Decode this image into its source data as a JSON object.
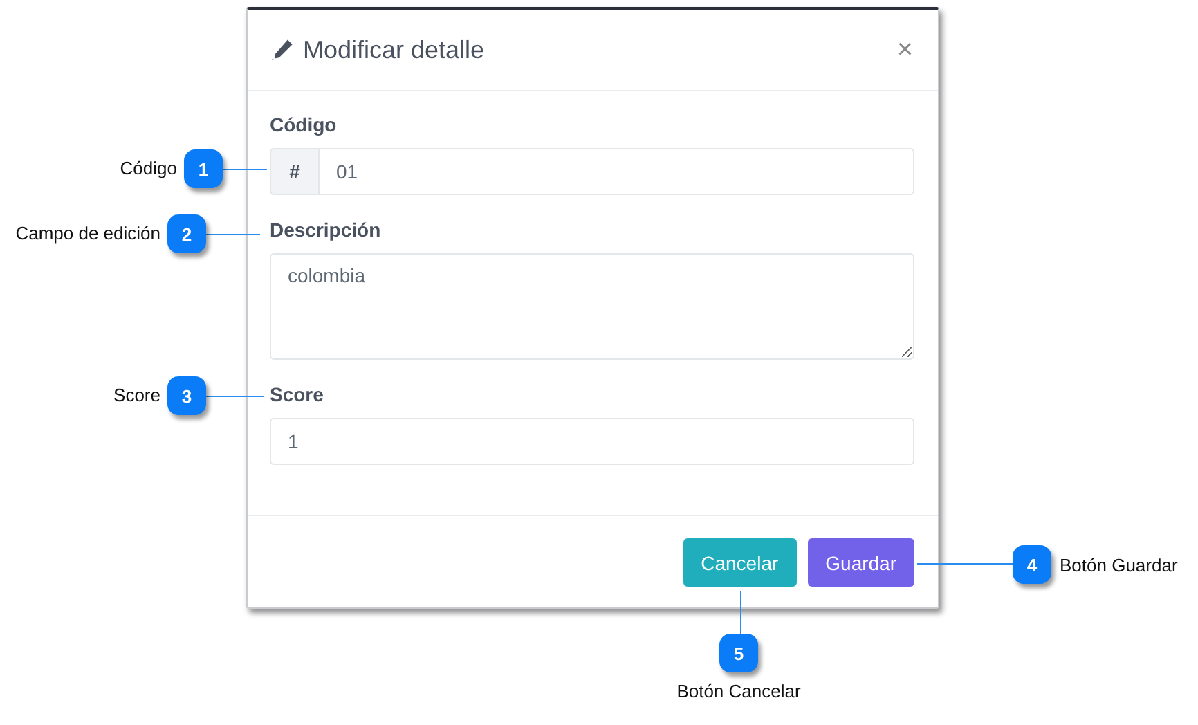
{
  "dialog": {
    "title": "Modificar detalle",
    "close": "×",
    "fields": [
      {
        "kind": "addon",
        "label": "Código",
        "addon": "#",
        "value": "01"
      },
      {
        "kind": "textarea",
        "label": "Descripción",
        "value": "colombia"
      },
      {
        "kind": "text",
        "label": "Score",
        "value": "1"
      }
    ],
    "buttons": [
      {
        "kind": "info",
        "label": "Cancelar"
      },
      {
        "kind": "primary",
        "label": "Guardar"
      }
    ]
  },
  "callouts": [
    {
      "number": "1",
      "label": "Código"
    },
    {
      "number": "2",
      "label": "Campo de edición"
    },
    {
      "number": "3",
      "label": "Score"
    },
    {
      "number": "4",
      "label": "Botón Guardar"
    },
    {
      "number": "5",
      "label": "Botón Cancelar"
    }
  ]
}
